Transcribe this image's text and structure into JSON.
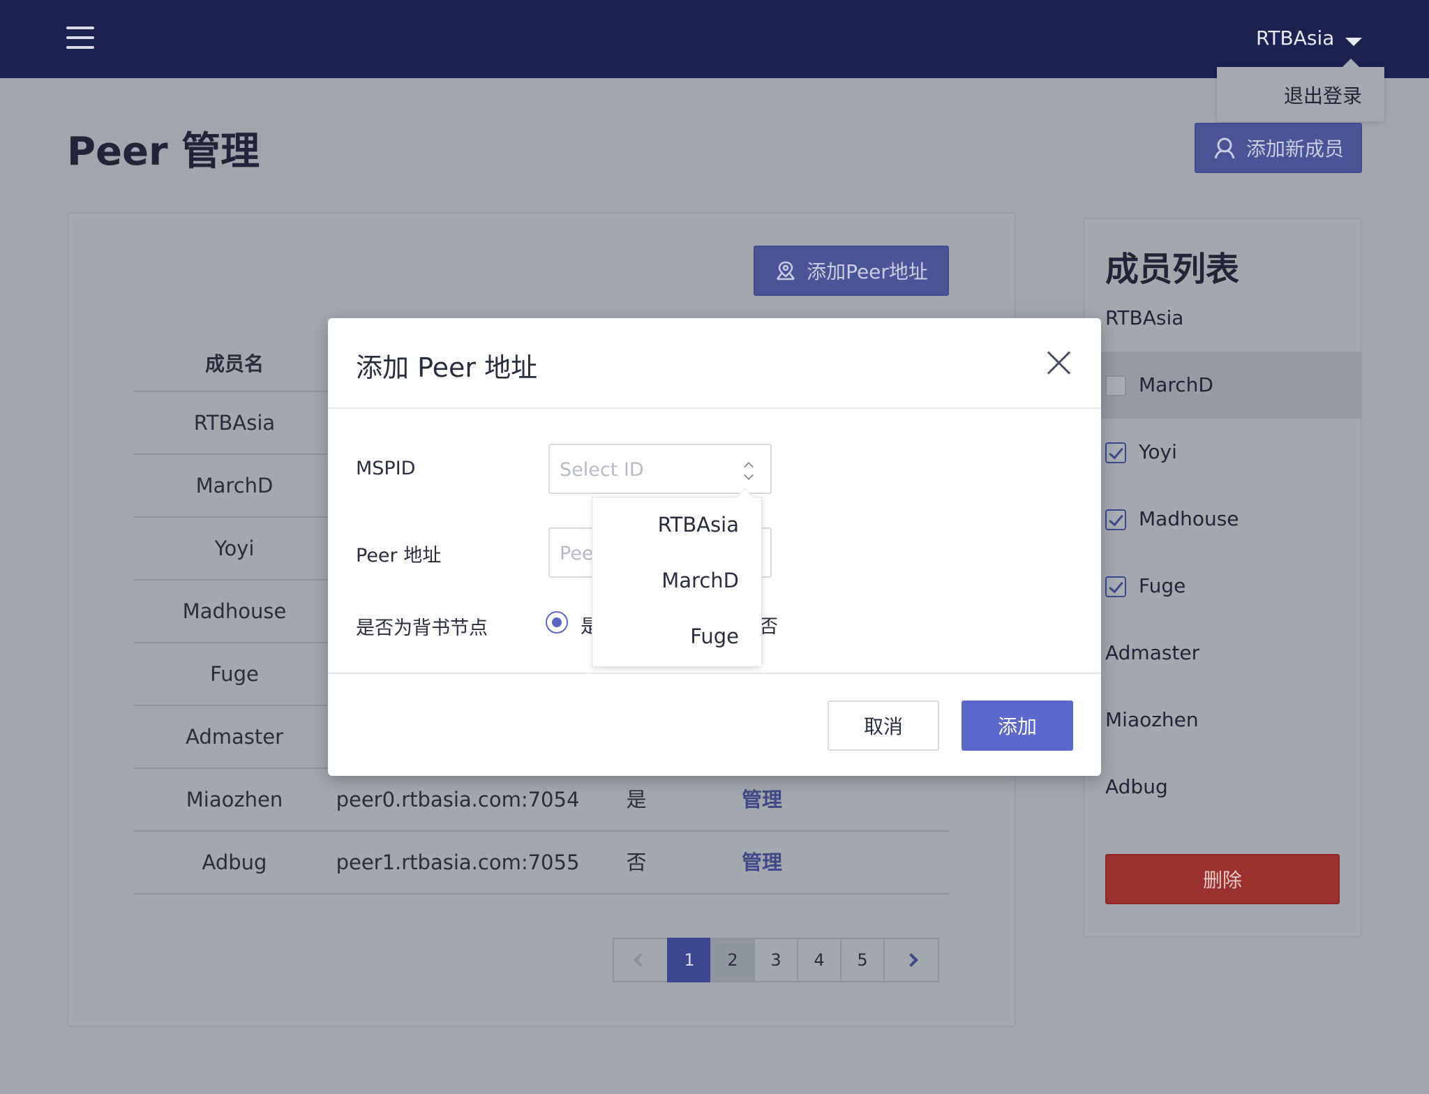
{
  "header": {
    "user": "RTBAsia",
    "logout": "退出登录"
  },
  "page_title": "Peer 管理",
  "buttons": {
    "add_member": "添加新成员",
    "add_peer": "添加Peer地址",
    "delete": "删除"
  },
  "table": {
    "header_name": "成员名",
    "rows": [
      {
        "name": "RTBAsia",
        "address": "",
        "endorse": "",
        "manage": ""
      },
      {
        "name": "MarchD",
        "address": "",
        "endorse": "",
        "manage": ""
      },
      {
        "name": "Yoyi",
        "address": "",
        "endorse": "",
        "manage": ""
      },
      {
        "name": "Madhouse",
        "address": "",
        "endorse": "",
        "manage": ""
      },
      {
        "name": "Fuge",
        "address": "",
        "endorse": "",
        "manage": ""
      },
      {
        "name": "Admaster",
        "address": "",
        "endorse": "",
        "manage": ""
      },
      {
        "name": "Miaozhen",
        "address": "peer0.rtbasia.com:7054",
        "endorse": "是",
        "manage": "管理"
      },
      {
        "name": "Adbug",
        "address": "peer1.rtbasia.com:7055",
        "endorse": "否",
        "manage": "管理"
      }
    ]
  },
  "pagination": {
    "pages": [
      "1",
      "2",
      "3",
      "4",
      "5"
    ],
    "current": "1"
  },
  "members": {
    "title": "成员列表",
    "items": [
      {
        "name": "RTBAsia",
        "checkbox": "none"
      },
      {
        "name": "MarchD",
        "checkbox": "unchecked"
      },
      {
        "name": "Yoyi",
        "checkbox": "checked"
      },
      {
        "name": "Madhouse",
        "checkbox": "checked"
      },
      {
        "name": "Fuge",
        "checkbox": "checked"
      },
      {
        "name": "Admaster",
        "checkbox": "none"
      },
      {
        "name": "Miaozhen",
        "checkbox": "none"
      },
      {
        "name": "Adbug",
        "checkbox": "none"
      }
    ]
  },
  "modal": {
    "title": "添加 Peer 地址",
    "mspid_label": "MSPID",
    "mspid_placeholder": "Select ID",
    "peer_label": "Peer 地址",
    "peer_placeholder": "Peer",
    "endorse_label": "是否为背书节点",
    "radio_yes": "是",
    "radio_no": "否",
    "dropdown_options": [
      "RTBAsia",
      "MarchD",
      "Fuge"
    ],
    "cancel": "取消",
    "add": "添加"
  },
  "colors": {
    "header_bg": "#1b2150",
    "primary": "#5b68cc",
    "danger": "#9b312c"
  }
}
